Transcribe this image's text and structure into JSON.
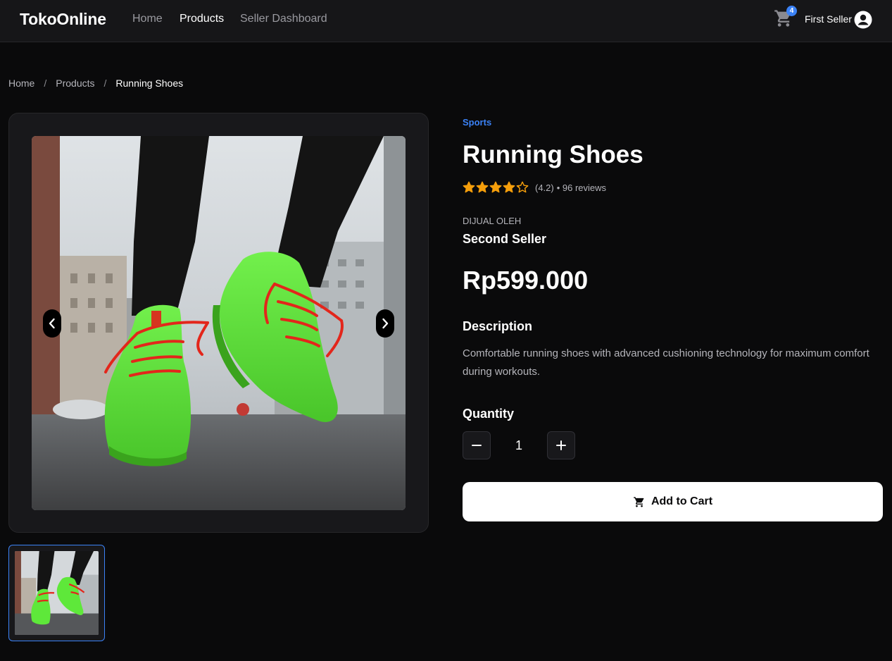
{
  "header": {
    "brand": "TokoOnline",
    "nav": [
      {
        "label": "Home",
        "active": false
      },
      {
        "label": "Products",
        "active": true
      },
      {
        "label": "Seller Dashboard",
        "active": false
      }
    ],
    "cart_icon": "shopping-cart-icon",
    "cart_count": "4",
    "user_name": "First Seller",
    "user_icon": "user-circle-icon"
  },
  "breadcrumb": {
    "items": [
      "Home",
      "Products",
      "Running Shoes"
    ],
    "separator": "/"
  },
  "gallery": {
    "image_alt": "Green running shoes with red laces",
    "prev_icon": "chevron-left-icon",
    "next_icon": "chevron-right-icon",
    "thumbnail_count": 1
  },
  "product": {
    "category": "Sports",
    "title": "Running Shoes",
    "rating_value": 4.2,
    "rating_max": 5,
    "rating_text": "(4.2)",
    "reviews_text": "• 96 reviews",
    "sold_by_label": "DIJUAL OLEH",
    "seller": "Second Seller",
    "price": "Rp599.000",
    "description_heading": "Description",
    "description": "Comfortable running shoes with advanced cushioning technology for maximum comfort during workouts.",
    "quantity_heading": "Quantity",
    "quantity": "1",
    "add_to_cart_label": "Add to Cart"
  },
  "colors": {
    "background": "#0a0a0b",
    "accent": "#3b82f6",
    "star": "#f59e0b",
    "shoe": "#5ee83a",
    "laces": "#e3261b"
  }
}
